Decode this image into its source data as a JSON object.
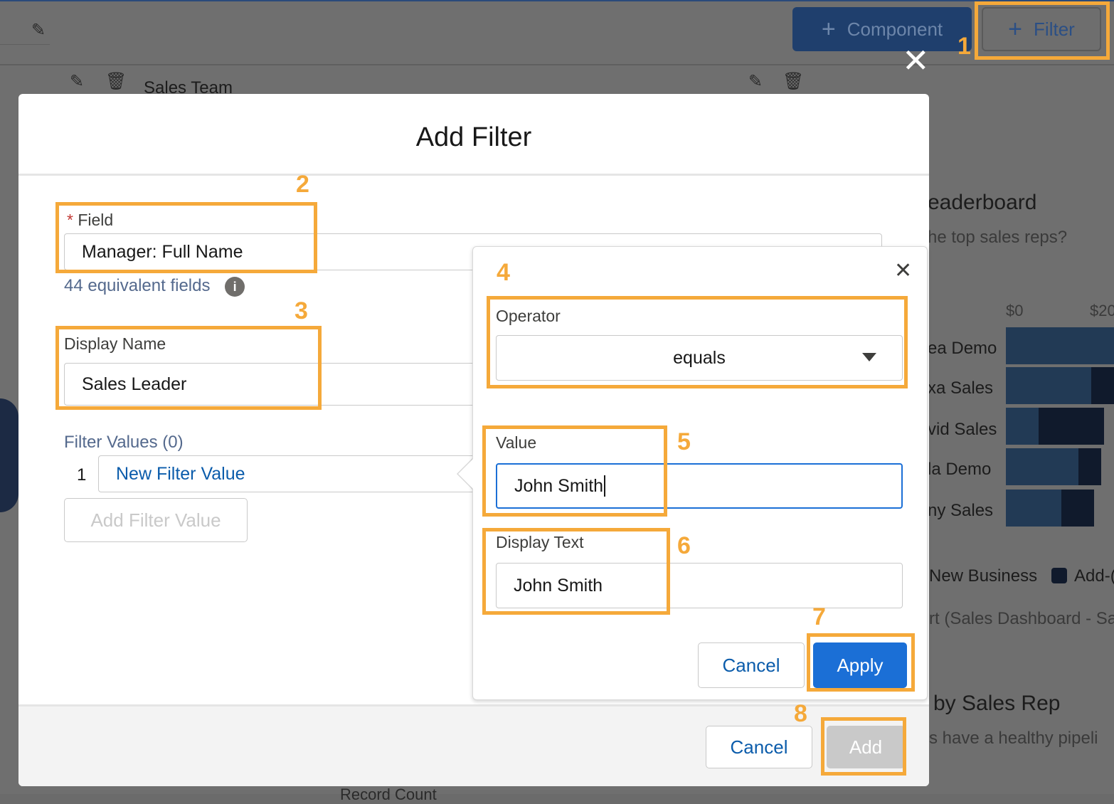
{
  "toolbar": {
    "component_label": "Component",
    "filter_label": "Filter"
  },
  "background": {
    "sales_team": "Sales Team",
    "leaderboard_title": "eaderboard",
    "leaderboard_sub": "he top sales reps?",
    "axis_0": "$0",
    "axis_20": "$20",
    "reps": [
      "ea Demo",
      "xa Sales",
      "vid Sales",
      "la Demo",
      "ny Sales"
    ],
    "legend_new": "New Business",
    "legend_add": "Add-(",
    "source": "rt (Sales Dashboard - Sa",
    "panel2_title": "by Sales Rep",
    "panel2_sub": "s have a healthy pipeli",
    "record_count": "Record Count"
  },
  "modal": {
    "title": "Add Filter",
    "field_label": "Field",
    "field_required": "*",
    "field_value": "Manager: Full Name",
    "equivalent_fields": "44 equivalent fields",
    "display_name_label": "Display Name",
    "display_name_value": "Sales Leader",
    "filter_values_label": "Filter Values (0)",
    "filter_row_index": "1",
    "filter_row_value": "New Filter Value",
    "add_filter_value": "Add Filter Value",
    "cancel": "Cancel",
    "add": "Add"
  },
  "popover": {
    "operator_label": "Operator",
    "operator_value": "equals",
    "value_label": "Value",
    "value_value": "John Smith",
    "display_text_label": "Display Text",
    "display_text_value": "John Smith",
    "cancel": "Cancel",
    "apply": "Apply"
  },
  "steps": [
    "1",
    "2",
    "3",
    "4",
    "5",
    "6",
    "7",
    "8"
  ],
  "colors": {
    "highlight": "#f5a93a",
    "brand_blue": "#0b5cab",
    "apply_bg": "#1b6fd6"
  }
}
